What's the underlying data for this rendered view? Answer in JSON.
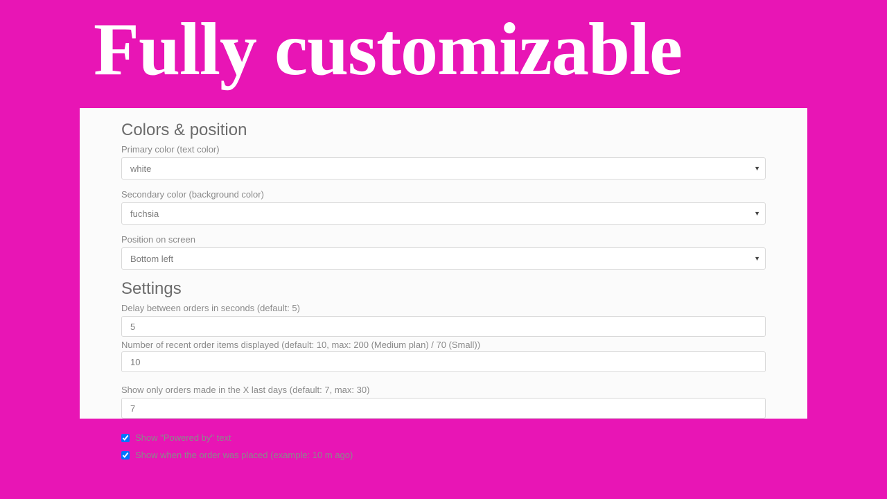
{
  "hero": {
    "title": "Fully customizable"
  },
  "sections": {
    "colors": {
      "heading": "Colors & position",
      "primary_label": "Primary color (text color)",
      "primary_value": "white",
      "secondary_label": "Secondary color (background color)",
      "secondary_value": "fuchsia",
      "position_label": "Position on screen",
      "position_value": "Bottom left"
    },
    "settings": {
      "heading": "Settings",
      "delay_label": "Delay between orders in seconds (default: 5)",
      "delay_value": "5",
      "items_label": "Number of recent order items displayed (default: 10, max: 200 (Medium plan) / 70 (Small))",
      "items_value": "10",
      "days_label": "Show only orders made in the X last days (default: 7, max: 30)",
      "days_value": "7",
      "powered_label": "Show \"Powered by\" text",
      "powered_checked": true,
      "placed_label": "Show when the order was placed (example: 10 m ago)",
      "placed_checked": true
    }
  }
}
